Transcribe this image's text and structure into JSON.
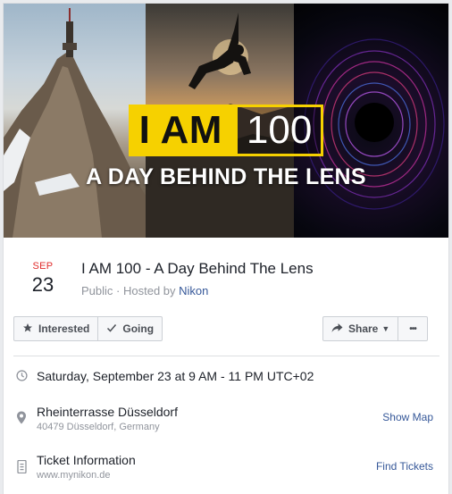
{
  "cover": {
    "badge_left": "I AM",
    "badge_right": "100",
    "subtitle": "A DAY BEHIND THE LENS"
  },
  "event": {
    "month": "SEP",
    "day": "23",
    "title": "I AM 100 - A Day Behind The Lens",
    "visibility": "Public",
    "hosted_by_prefix": "· Hosted by",
    "host": "Nikon"
  },
  "actions": {
    "interested": "Interested",
    "going": "Going",
    "share": "Share",
    "more": "•••"
  },
  "details": {
    "datetime": "Saturday, September 23 at 9 AM - 11 PM UTC+02",
    "location_name": "Rheinterrasse Düsseldorf",
    "location_address": "40479 Düsseldorf, Germany",
    "show_map": "Show Map",
    "ticket_title": "Ticket Information",
    "ticket_url": "www.mynikon.de",
    "find_tickets": "Find Tickets"
  },
  "colors": {
    "accent_yellow": "#f6d100",
    "month_red": "#e02c2c",
    "link_blue": "#365899",
    "muted_gray": "#90949c"
  }
}
